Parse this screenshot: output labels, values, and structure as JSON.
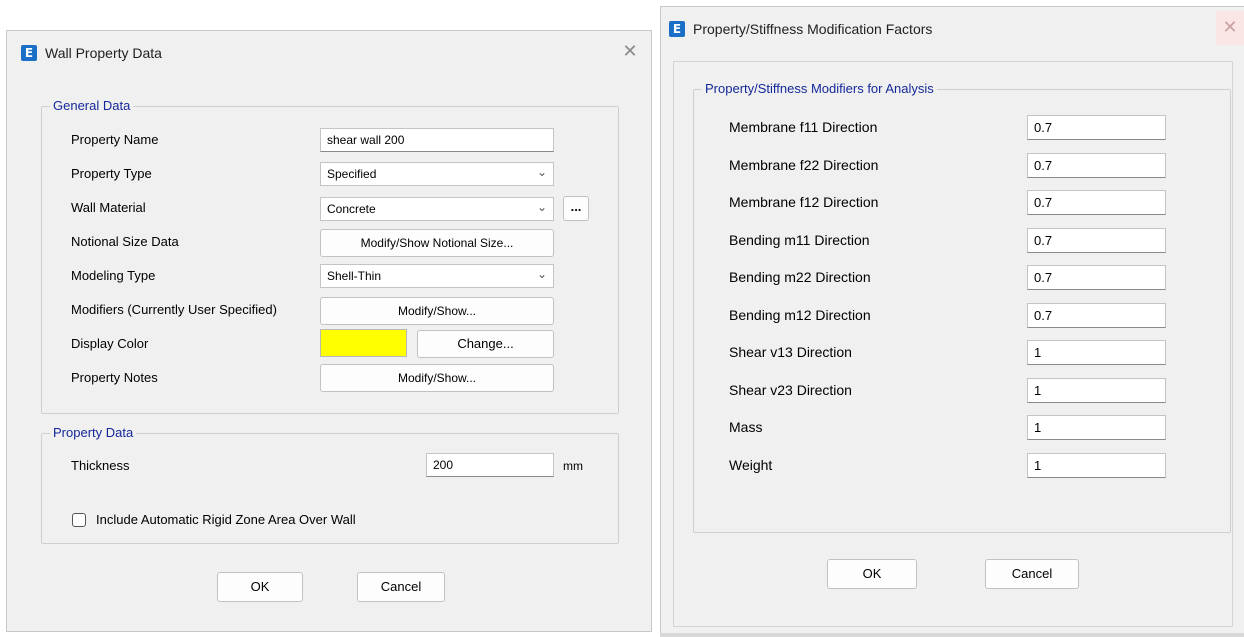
{
  "wall_dialog": {
    "title": "Wall Property Data",
    "general_group": "General Data",
    "property_name_label": "Property Name",
    "property_name_value": "shear wall 200",
    "property_type_label": "Property Type",
    "property_type_value": "Specified",
    "wall_material_label": "Wall Material",
    "wall_material_value": "Concrete",
    "ellipsis_label": "...",
    "notional_label": "Notional Size Data",
    "notional_button": "Modify/Show Notional Size...",
    "modeling_label": "Modeling Type",
    "modeling_value": "Shell-Thin",
    "modifiers_label": "Modifiers (Currently User Specified)",
    "modifiers_button": "Modify/Show...",
    "color_label": "Display Color",
    "color_value": "#ffff00",
    "change_button": "Change...",
    "notes_label": "Property Notes",
    "notes_button": "Modify/Show...",
    "property_group": "Property Data",
    "thickness_label": "Thickness",
    "thickness_value": "200",
    "thickness_unit": "mm",
    "rigid_zone_label": "Include Automatic Rigid Zone Area Over Wall",
    "rigid_zone_checked": false,
    "ok": "OK",
    "cancel": "Cancel"
  },
  "modifiers_dialog": {
    "title": "Property/Stiffness Modification Factors",
    "group": "Property/Stiffness Modifiers for Analysis",
    "rows": [
      {
        "label": "Membrane f11 Direction",
        "value": "0.7"
      },
      {
        "label": "Membrane f22 Direction",
        "value": "0.7"
      },
      {
        "label": "Membrane f12 Direction",
        "value": "0.7"
      },
      {
        "label": "Bending m11 Direction",
        "value": "0.7"
      },
      {
        "label": "Bending m22 Direction",
        "value": "0.7"
      },
      {
        "label": "Bending m12 Direction",
        "value": "0.7"
      },
      {
        "label": "Shear v13 Direction",
        "value": "1"
      },
      {
        "label": "Shear v23 Direction",
        "value": "1"
      },
      {
        "label": "Mass",
        "value": "1"
      },
      {
        "label": "Weight",
        "value": "1"
      }
    ],
    "ok": "OK",
    "cancel": "Cancel"
  }
}
